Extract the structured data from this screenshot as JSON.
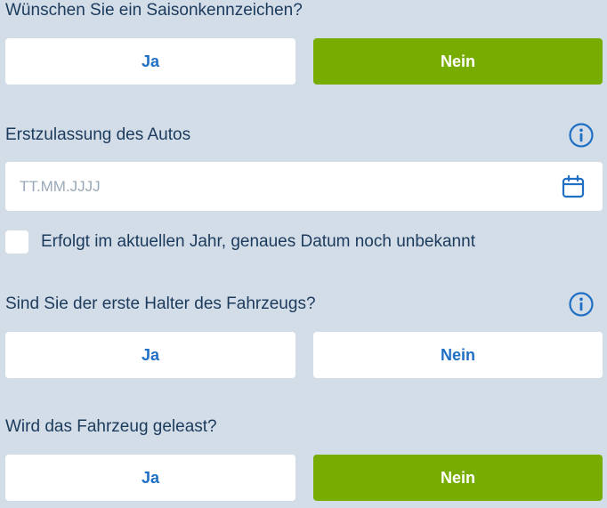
{
  "season_plate": {
    "question": "Wünschen Sie ein Saisonkennzeichen?",
    "yes_label": "Ja",
    "no_label": "Nein",
    "selected": "Nein"
  },
  "first_registration": {
    "label": "Erstzulassung des Autos",
    "info_icon": "info-icon",
    "placeholder": "TT.MM.JJJJ",
    "value": "",
    "calendar_icon": "calendar-icon"
  },
  "unknown_date_checkbox": {
    "label": "Erfolgt im aktuellen Jahr, genaues Datum noch unbekannt",
    "checked": false
  },
  "first_owner": {
    "question": "Sind Sie der erste Halter des Fahrzeugs?",
    "info_icon": "info-icon",
    "yes_label": "Ja",
    "no_label": "Nein",
    "selected": ""
  },
  "leased": {
    "question": "Wird das Fahrzeug geleast?",
    "yes_label": "Ja",
    "no_label": "Nein",
    "selected": "Nein"
  },
  "colors": {
    "background": "#d3dde8",
    "selected_button": "#77ad00",
    "button_text": "#1f6fc4",
    "label_text": "#1b3a5c",
    "icon": "#1f6fc4"
  }
}
